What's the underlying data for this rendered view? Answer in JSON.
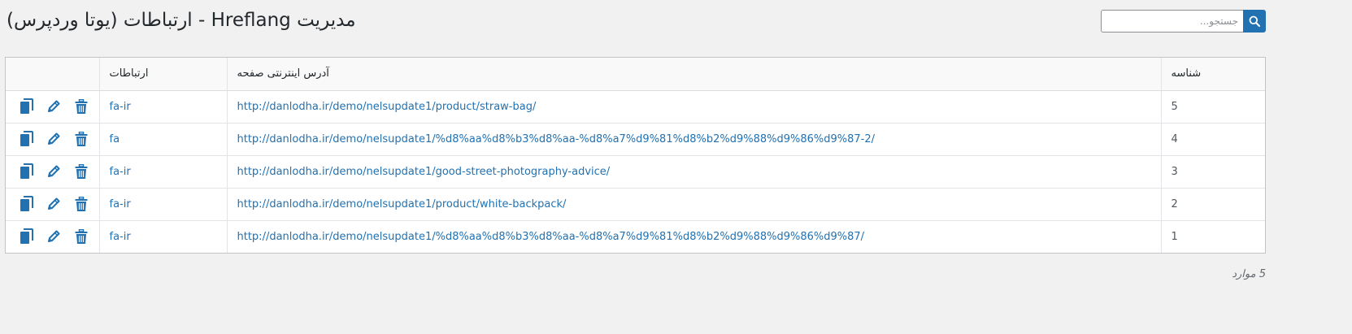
{
  "header": {
    "title": "مدیریت Hreflang - ارتباطات (یوتا وردپرس)"
  },
  "search": {
    "placeholder": "جستجو...",
    "icon": "search-icon",
    "button_color": "#2271b1"
  },
  "table": {
    "columns": {
      "id": "شناسه",
      "url": "آدرس اینترنتی صفحه",
      "links": "ارتباطات",
      "actions": ""
    },
    "rows": [
      {
        "id": "5",
        "url": "http://danlodha.ir/demo/nelsupdate1/product/straw-bag/",
        "link": "fa-ir"
      },
      {
        "id": "4",
        "url": "http://danlodha.ir/demo/nelsupdate1/%d8%aa%d8%b3%d8%aa-%d8%a7%d9%81%d8%b2%d9%88%d9%86%d9%87-2/",
        "link": "fa"
      },
      {
        "id": "3",
        "url": "http://danlodha.ir/demo/nelsupdate1/good-street-photography-advice/",
        "link": "fa-ir"
      },
      {
        "id": "2",
        "url": "http://danlodha.ir/demo/nelsupdate1/product/white-backpack/",
        "link": "fa-ir"
      },
      {
        "id": "1",
        "url": "http://danlodha.ir/demo/nelsupdate1/%d8%aa%d8%b3%d8%aa-%d8%a7%d9%81%d8%b2%d9%88%d9%86%d9%87/",
        "link": "fa-ir"
      }
    ],
    "row_actions": [
      "copy-icon",
      "edit-icon",
      "trash-icon"
    ]
  },
  "footer": {
    "count": "5 موارد"
  },
  "colors": {
    "accent": "#2271b1",
    "background": "#f1f1f1"
  }
}
